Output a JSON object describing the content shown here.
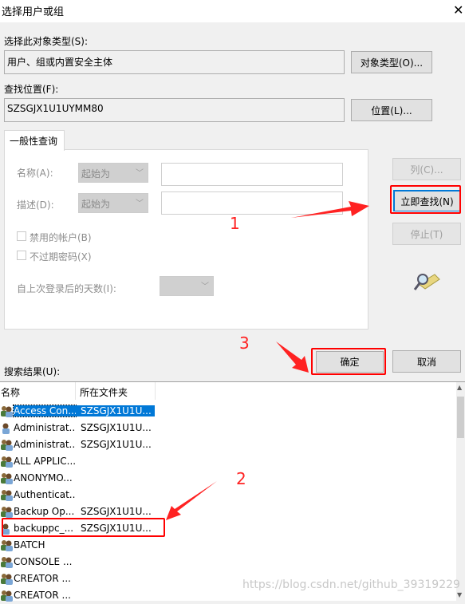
{
  "window": {
    "title": "选择用户或组",
    "close_icon": "close-icon"
  },
  "object_type": {
    "label": "选择此对象类型(S):",
    "value": "用户、组或内置安全主体",
    "button": "对象类型(O)..."
  },
  "location": {
    "label": "查找位置(F):",
    "value": "SZSGJX1U1UYMM80",
    "button": "位置(L)..."
  },
  "query": {
    "tab": "一般性查询",
    "name_label": "名称(A):",
    "name_mode": "起始为",
    "name_value": "",
    "desc_label": "描述(D):",
    "desc_mode": "起始为",
    "desc_value": "",
    "disabled_accounts": "禁用的帐户(B)",
    "non_expiring": "不过期密码(X)",
    "days_label": "自上次登录后的天数(I):",
    "days_value": ""
  },
  "buttons": {
    "columns": "列(C)...",
    "find_now": "立即查找(N)",
    "stop": "停止(T)",
    "ok": "确定",
    "cancel": "取消"
  },
  "results": {
    "label": "搜索结果(U):",
    "headers": [
      "名称",
      "所在文件夹"
    ],
    "rows": [
      {
        "name": "Access Con...",
        "folder": "SZSGJX1U1U...",
        "icon": "group-icon",
        "selected": true
      },
      {
        "name": "Administrat...",
        "folder": "SZSGJX1U1U...",
        "icon": "user-icon"
      },
      {
        "name": "Administrat...",
        "folder": "SZSGJX1U1U...",
        "icon": "group-icon"
      },
      {
        "name": "ALL APPLIC...",
        "folder": "",
        "icon": "group-icon"
      },
      {
        "name": "ANONYMO...",
        "folder": "",
        "icon": "group-icon"
      },
      {
        "name": "Authenticat...",
        "folder": "",
        "icon": "group-icon"
      },
      {
        "name": "Backup Op...",
        "folder": "SZSGJX1U1U...",
        "icon": "group-icon"
      },
      {
        "name": "backuppc_...",
        "folder": "SZSGJX1U1U...",
        "icon": "user-icon"
      },
      {
        "name": "BATCH",
        "folder": "",
        "icon": "group-icon"
      },
      {
        "name": "CONSOLE ...",
        "folder": "",
        "icon": "group-icon"
      },
      {
        "name": "CREATOR ...",
        "folder": "",
        "icon": "group-icon"
      },
      {
        "name": "CREATOR ...",
        "folder": "",
        "icon": "group-icon"
      }
    ]
  },
  "annotations": {
    "step1": "1",
    "step2": "2",
    "step3": "3",
    "color": "#ff2222"
  },
  "watermark": "https://blog.csdn.net/github_39319229"
}
